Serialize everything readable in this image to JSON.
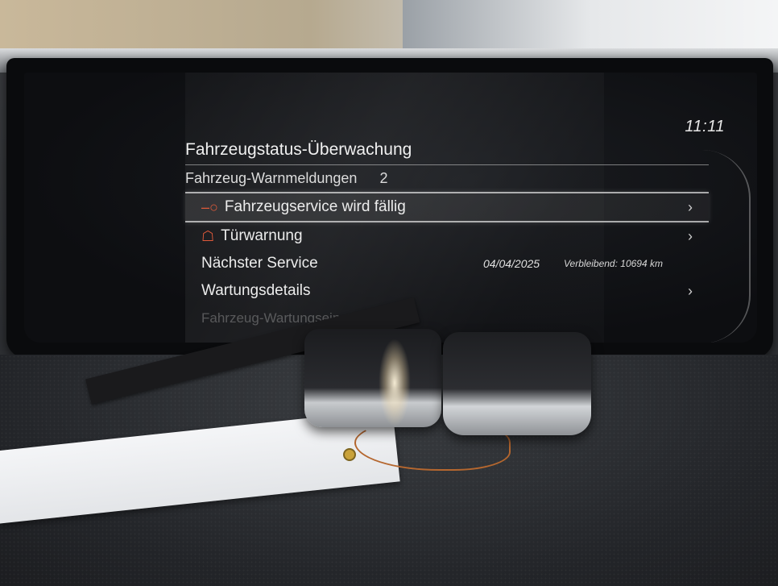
{
  "clock": {
    "time": "11:11"
  },
  "menu": {
    "title": "Fahrzeugstatus-Überwachung",
    "warnings_label": "Fahrzeug-Warnmeldungen",
    "warnings_count": "2",
    "items": [
      {
        "label": "Fahrzeugservice wird fällig",
        "icon": "wrench-icon",
        "selected": true
      },
      {
        "label": "Türwarnung",
        "icon": "car-door-icon",
        "selected": false
      },
      {
        "label": "Nächster Service",
        "date": "04/04/2025",
        "remaining": "Verbleibend: 10694 km"
      },
      {
        "label": "Wartungsdetails"
      },
      {
        "label": "Fahrzeug-Wartungseinstellungen"
      }
    ],
    "chevron": "›"
  },
  "colors": {
    "warning_icon": "#e05a3a",
    "text": "#ececec",
    "screen_bg": "#0d0e11"
  }
}
